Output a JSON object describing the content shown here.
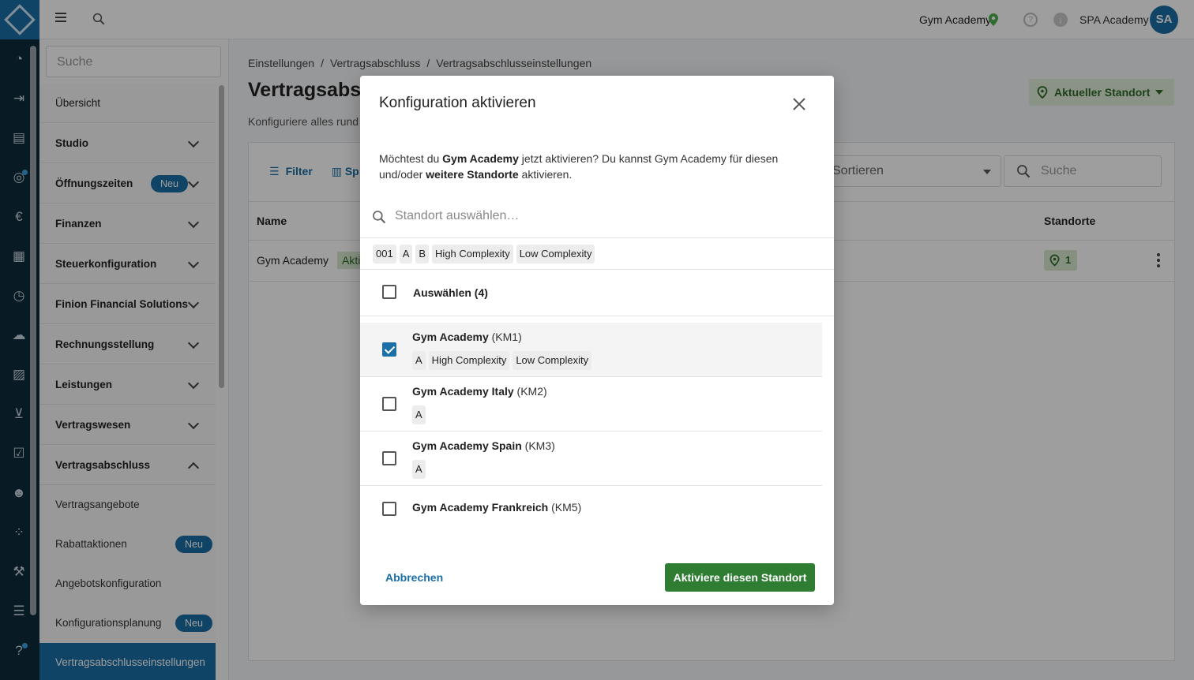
{
  "topbar": {
    "studio_name": "Gym Academy",
    "org_name": "SPA Academy",
    "avatar_initials": "SA"
  },
  "sidebar": {
    "search_placeholder": "Suche",
    "items": [
      {
        "label": "Übersicht"
      },
      {
        "label": "Studio"
      },
      {
        "label": "Öffnungszeiten",
        "badge": "Neu"
      },
      {
        "label": "Finanzen"
      },
      {
        "label": "Steuerkonfiguration"
      },
      {
        "label": "Finion Financial Solutions"
      },
      {
        "label": "Rechnungsstellung"
      },
      {
        "label": "Leistungen"
      },
      {
        "label": "Vertragswesen"
      },
      {
        "label": "Vertragsabschluss"
      }
    ],
    "subitems": [
      {
        "label": "Vertragsangebote"
      },
      {
        "label": "Rabattaktionen",
        "badge": "Neu"
      },
      {
        "label": "Angebotskonfiguration"
      },
      {
        "label": "Konfigurationsplanung",
        "badge": "Neu"
      },
      {
        "label": "Vertragsabschlusseinstellungen"
      }
    ]
  },
  "main": {
    "breadcrumb": [
      "Einstellungen",
      "Vertragsabschluss",
      "Vertragsabschlusseinstellungen"
    ],
    "title": "Vertragsabsc",
    "subtitle": "Konfiguriere alles rund",
    "standort_button": "Aktueller Standort",
    "filter_label": "Filter",
    "columns_label": "Sp",
    "sort_placeholder": "Sortieren",
    "search_placeholder": "Suche",
    "table": {
      "headers": [
        "Name",
        "Standorte"
      ],
      "rows": [
        {
          "name": "Gym Academy",
          "status": "Aktiv",
          "standorte_count": "1"
        }
      ]
    }
  },
  "modal": {
    "title": "Konfiguration aktivieren",
    "desc_1": "Möchtest du ",
    "desc_bold_1": "Gym Academy",
    "desc_2": " jetzt aktivieren? Du kannst Gym Academy für diesen und/oder ",
    "desc_bold_2": "weitere Standorte",
    "desc_3": " aktivieren.",
    "search_placeholder": "Standort auswählen…",
    "filter_chips": [
      "001",
      "A",
      "B",
      "High Complexity",
      "Low Complexity"
    ],
    "select_all_label": "Auswählen (4)",
    "locations": [
      {
        "name": "Gym Academy",
        "code": "(KM1)",
        "tags": [
          "A",
          "High Complexity",
          "Low Complexity"
        ],
        "checked": true
      },
      {
        "name": "Gym Academy Italy",
        "code": "(KM2)",
        "tags": [
          "A"
        ],
        "checked": false
      },
      {
        "name": "Gym Academy Spain",
        "code": "(KM3)",
        "tags": [
          "A"
        ],
        "checked": false
      },
      {
        "name": "Gym Academy Frankreich",
        "code": "(KM5)",
        "tags": [],
        "checked": false
      }
    ],
    "cancel_label": "Abbrechen",
    "activate_label": "Aktiviere diesen Standort"
  },
  "colors": {
    "brand_blue": "#1a6fa6",
    "rail_dark": "#0e2a3a",
    "primary_green": "#2f7d32",
    "overlay": "rgba(0,0,0,0.38)"
  }
}
